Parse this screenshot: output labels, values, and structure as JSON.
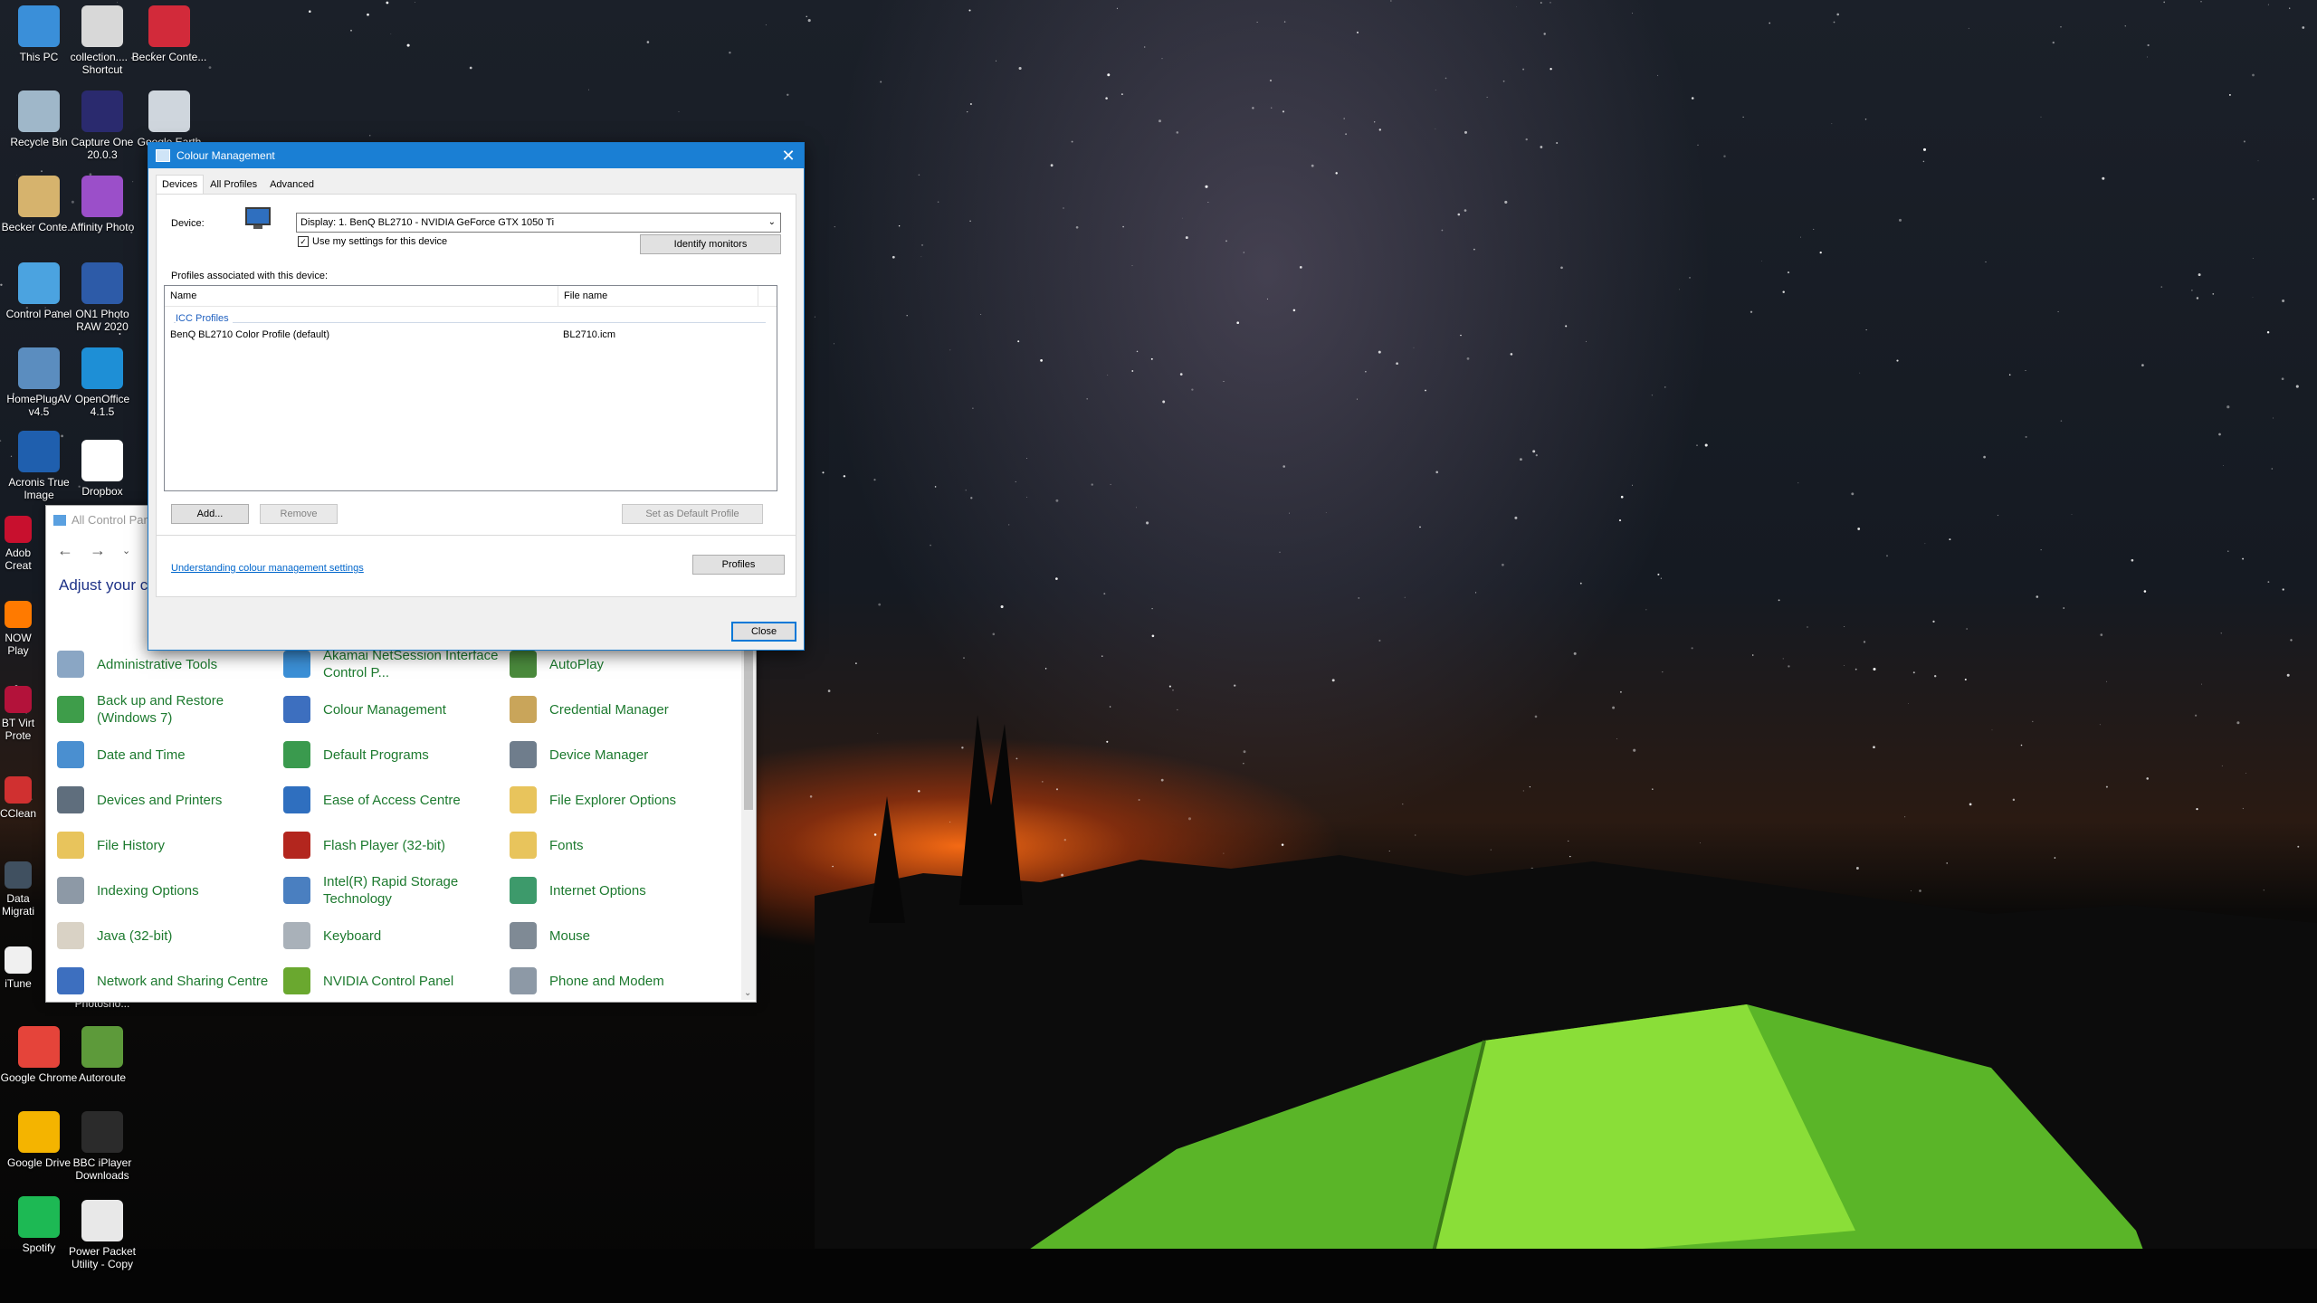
{
  "desktop_icons": [
    {
      "label": "This PC",
      "icon": "pc-icon",
      "color": "#3a8fd9"
    },
    {
      "label": "collection.... - Shortcut",
      "icon": "document-icon",
      "color": "#d8d8d8"
    },
    {
      "label": "Becker Conte...",
      "icon": "becker-icon",
      "color": "#d22a3a"
    },
    {
      "label": "Recycle Bin",
      "icon": "recycle-bin-icon",
      "color": "#9fb7c9"
    },
    {
      "label": "Capture One 20.0.3",
      "icon": "capture-one-icon",
      "color": "#2a2a6e"
    },
    {
      "label": "Google Earth",
      "icon": "google-earth-icon",
      "color": "#cfd6dd"
    },
    {
      "label": "Becker Conte...",
      "icon": "becker-file-icon",
      "color": "#d6b36d"
    },
    {
      "label": "Affinity Photo",
      "icon": "affinity-photo-icon",
      "color": "#9b4fc9"
    },
    {
      "label": "Control Panel",
      "icon": "control-panel-icon",
      "color": "#4ba3e0"
    },
    {
      "label": "ON1 Photo RAW 2020",
      "icon": "on1-icon",
      "color": "#2d5ba8"
    },
    {
      "label": "HomePlugAV v4.5",
      "icon": "homeplug-icon",
      "color": "#5b8dbf"
    },
    {
      "label": "OpenOffice 4.1.5",
      "icon": "openoffice-icon",
      "color": "#1e8fd6"
    },
    {
      "label": "Acronis True Image",
      "icon": "acronis-icon",
      "color": "#1f5fae"
    },
    {
      "label": "Dropbox",
      "icon": "dropbox-icon",
      "color": "#ffffff"
    },
    {
      "label": "Google Chrome",
      "icon": "chrome-icon",
      "color": "#e5443a"
    },
    {
      "label": "Autoroute",
      "icon": "autoroute-icon",
      "color": "#5d9a3a"
    },
    {
      "label": "Google Drive",
      "icon": "google-drive-icon",
      "color": "#f4b400"
    },
    {
      "label": "BBC iPlayer Downloads",
      "icon": "iplayer-icon",
      "color": "#2b2b2b"
    },
    {
      "label": "Spotify",
      "icon": "spotify-icon",
      "color": "#1db954"
    },
    {
      "label": "Power Packet Utility - Copy",
      "icon": "power-packet-icon",
      "color": "#e8e8e8"
    }
  ],
  "partial_icons": [
    "Adob Creat",
    "NOW Play",
    "BT Virt Prote",
    "CClean",
    "Data Migrati",
    "iTune",
    "Photosho..."
  ],
  "control_panel": {
    "title": "All Control Pane",
    "heading": "Adjust your co",
    "items": [
      {
        "label": "Administrative Tools",
        "icon": "administrative-tools-icon",
        "color": "#8aa6c4"
      },
      {
        "label": "Akamai NetSession Interface Control P...",
        "icon": "akamai-icon",
        "color": "#3b8fd6"
      },
      {
        "label": "AutoPlay",
        "icon": "autoplay-icon",
        "color": "#4a8a3c"
      },
      {
        "label": "Back up and Restore (Windows 7)",
        "icon": "backup-icon",
        "color": "#3e9d4a"
      },
      {
        "label": "Colour Management",
        "icon": "colour-management-icon",
        "color": "#3d6fbf"
      },
      {
        "label": "Credential Manager",
        "icon": "credential-manager-icon",
        "color": "#c9a55a"
      },
      {
        "label": "Date and Time",
        "icon": "date-time-icon",
        "color": "#4a8fd0"
      },
      {
        "label": "Default Programs",
        "icon": "default-programs-icon",
        "color": "#3a9a4e"
      },
      {
        "label": "Device Manager",
        "icon": "device-manager-icon",
        "color": "#6f7d8c"
      },
      {
        "label": "Devices and Printers",
        "icon": "devices-printers-icon",
        "color": "#5f6e7d"
      },
      {
        "label": "Ease of Access Centre",
        "icon": "ease-of-access-icon",
        "color": "#2f6fbf"
      },
      {
        "label": "File Explorer Options",
        "icon": "file-explorer-options-icon",
        "color": "#e8c45c"
      },
      {
        "label": "File History",
        "icon": "file-history-icon",
        "color": "#e8c45c"
      },
      {
        "label": "Flash Player (32-bit)",
        "icon": "flash-player-icon",
        "color": "#b3261e"
      },
      {
        "label": "Fonts",
        "icon": "fonts-icon",
        "color": "#e8c45c"
      },
      {
        "label": "Indexing Options",
        "icon": "indexing-options-icon",
        "color": "#8d99a6"
      },
      {
        "label": "Intel(R) Rapid Storage Technology",
        "icon": "intel-rst-icon",
        "color": "#4a7fc0"
      },
      {
        "label": "Internet Options",
        "icon": "internet-options-icon",
        "color": "#3d9a6b"
      },
      {
        "label": "Java (32-bit)",
        "icon": "java-icon",
        "color": "#d9d2c5"
      },
      {
        "label": "Keyboard",
        "icon": "keyboard-icon",
        "color": "#a9b1b9"
      },
      {
        "label": "Mouse",
        "icon": "mouse-icon",
        "color": "#7f8a95"
      },
      {
        "label": "Network and Sharing Centre",
        "icon": "network-icon",
        "color": "#3d6fbf"
      },
      {
        "label": "NVIDIA Control Panel",
        "icon": "nvidia-icon",
        "color": "#6aa82f"
      },
      {
        "label": "Phone and Modem",
        "icon": "phone-modem-icon",
        "color": "#8d99a6"
      }
    ]
  },
  "dialog": {
    "title": "Colour Management",
    "tabs": [
      "Devices",
      "All Profiles",
      "Advanced"
    ],
    "device_label": "Device:",
    "device_value": "Display: 1. BenQ BL2710 - NVIDIA GeForce GTX 1050 Ti",
    "use_settings": "Use my settings for this device",
    "identify_monitors": "Identify monitors",
    "profiles_label": "Profiles associated with this device:",
    "col_name": "Name",
    "col_file": "File name",
    "group": "ICC Profiles",
    "rows": [
      {
        "name": "BenQ BL2710 Color Profile (default)",
        "file": "BL2710.icm"
      }
    ],
    "add": "Add...",
    "remove": "Remove",
    "set_default": "Set as Default Profile",
    "link": "Understanding colour management settings",
    "profiles_button": "Profiles",
    "close_button": "Close"
  }
}
